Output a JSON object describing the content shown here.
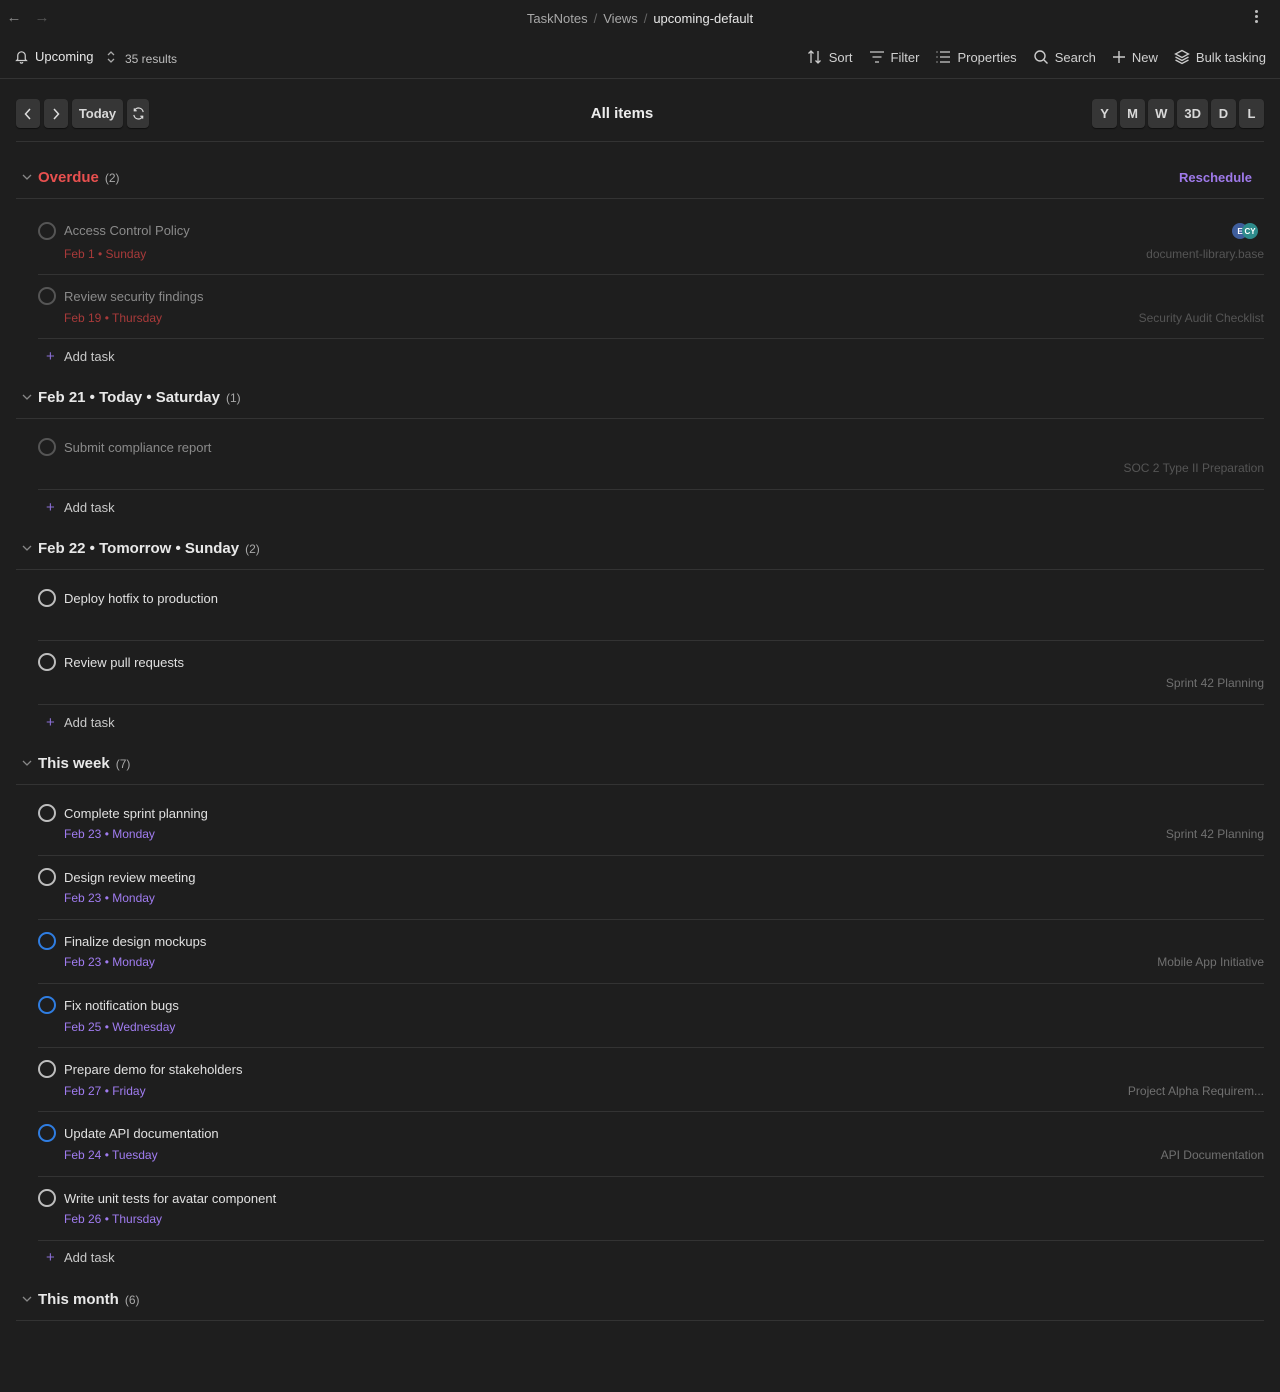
{
  "titlebar": {
    "breadcrumb": [
      "TaskNotes",
      "Views",
      "upcoming-default"
    ],
    "separator": "/"
  },
  "toolbar": {
    "view_label": "Upcoming",
    "results": "35 results",
    "actions": {
      "sort": "Sort",
      "filter": "Filter",
      "properties": "Properties",
      "search": "Search",
      "new": "New",
      "bulk": "Bulk tasking"
    }
  },
  "calendar": {
    "today_label": "Today",
    "title": "All items",
    "ranges": [
      "Y",
      "M",
      "W",
      "3D",
      "D",
      "L"
    ]
  },
  "add_task_label": "Add task",
  "reschedule_label": "Reschedule",
  "groups": [
    {
      "title": "Overdue",
      "count": "(2)",
      "tasks": [
        {
          "title": "Access Control Policy",
          "date": "Feb 1 • Sunday",
          "project": "document-library.base",
          "avatars": [
            "E",
            "CY"
          ]
        },
        {
          "title": "Review security findings",
          "date": "Feb 19 • Thursday",
          "project": "Security Audit Checklist"
        }
      ]
    },
    {
      "title": "Feb 21 • Today • Saturday",
      "count": "(1)",
      "tasks": [
        {
          "title": "Submit compliance report",
          "date": "",
          "project": "SOC 2 Type II Preparation"
        }
      ]
    },
    {
      "title": "Feb 22 • Tomorrow • Sunday",
      "count": "(2)",
      "tasks": [
        {
          "title": "Deploy hotfix to production",
          "date": "",
          "project": ""
        },
        {
          "title": "Review pull requests",
          "date": "",
          "project": "Sprint 42 Planning"
        }
      ]
    },
    {
      "title": "This week",
      "count": "(7)",
      "tasks": [
        {
          "title": "Complete sprint planning",
          "date": "Feb 23 • Monday",
          "project": "Sprint 42 Planning"
        },
        {
          "title": "Design review meeting",
          "date": "Feb 23 • Monday",
          "project": ""
        },
        {
          "title": "Finalize design mockups",
          "date": "Feb 23 • Monday",
          "project": "Mobile App Initiative"
        },
        {
          "title": "Fix notification bugs",
          "date": "Feb 25 • Wednesday",
          "project": ""
        },
        {
          "title": "Prepare demo for stakeholders",
          "date": "Feb 27 • Friday",
          "project": "Project Alpha Requirem..."
        },
        {
          "title": "Update API documentation",
          "date": "Feb 24 • Tuesday",
          "project": "API Documentation"
        },
        {
          "title": "Write unit tests for avatar component",
          "date": "Feb 26 • Thursday",
          "project": ""
        }
      ]
    },
    {
      "title": "This month",
      "count": "(6)",
      "tasks": []
    }
  ],
  "colors": {
    "overdue": "#e8504f",
    "accent": "#a07cf0",
    "in_progress": "#2f7de1",
    "background": "#1e1e1e"
  }
}
